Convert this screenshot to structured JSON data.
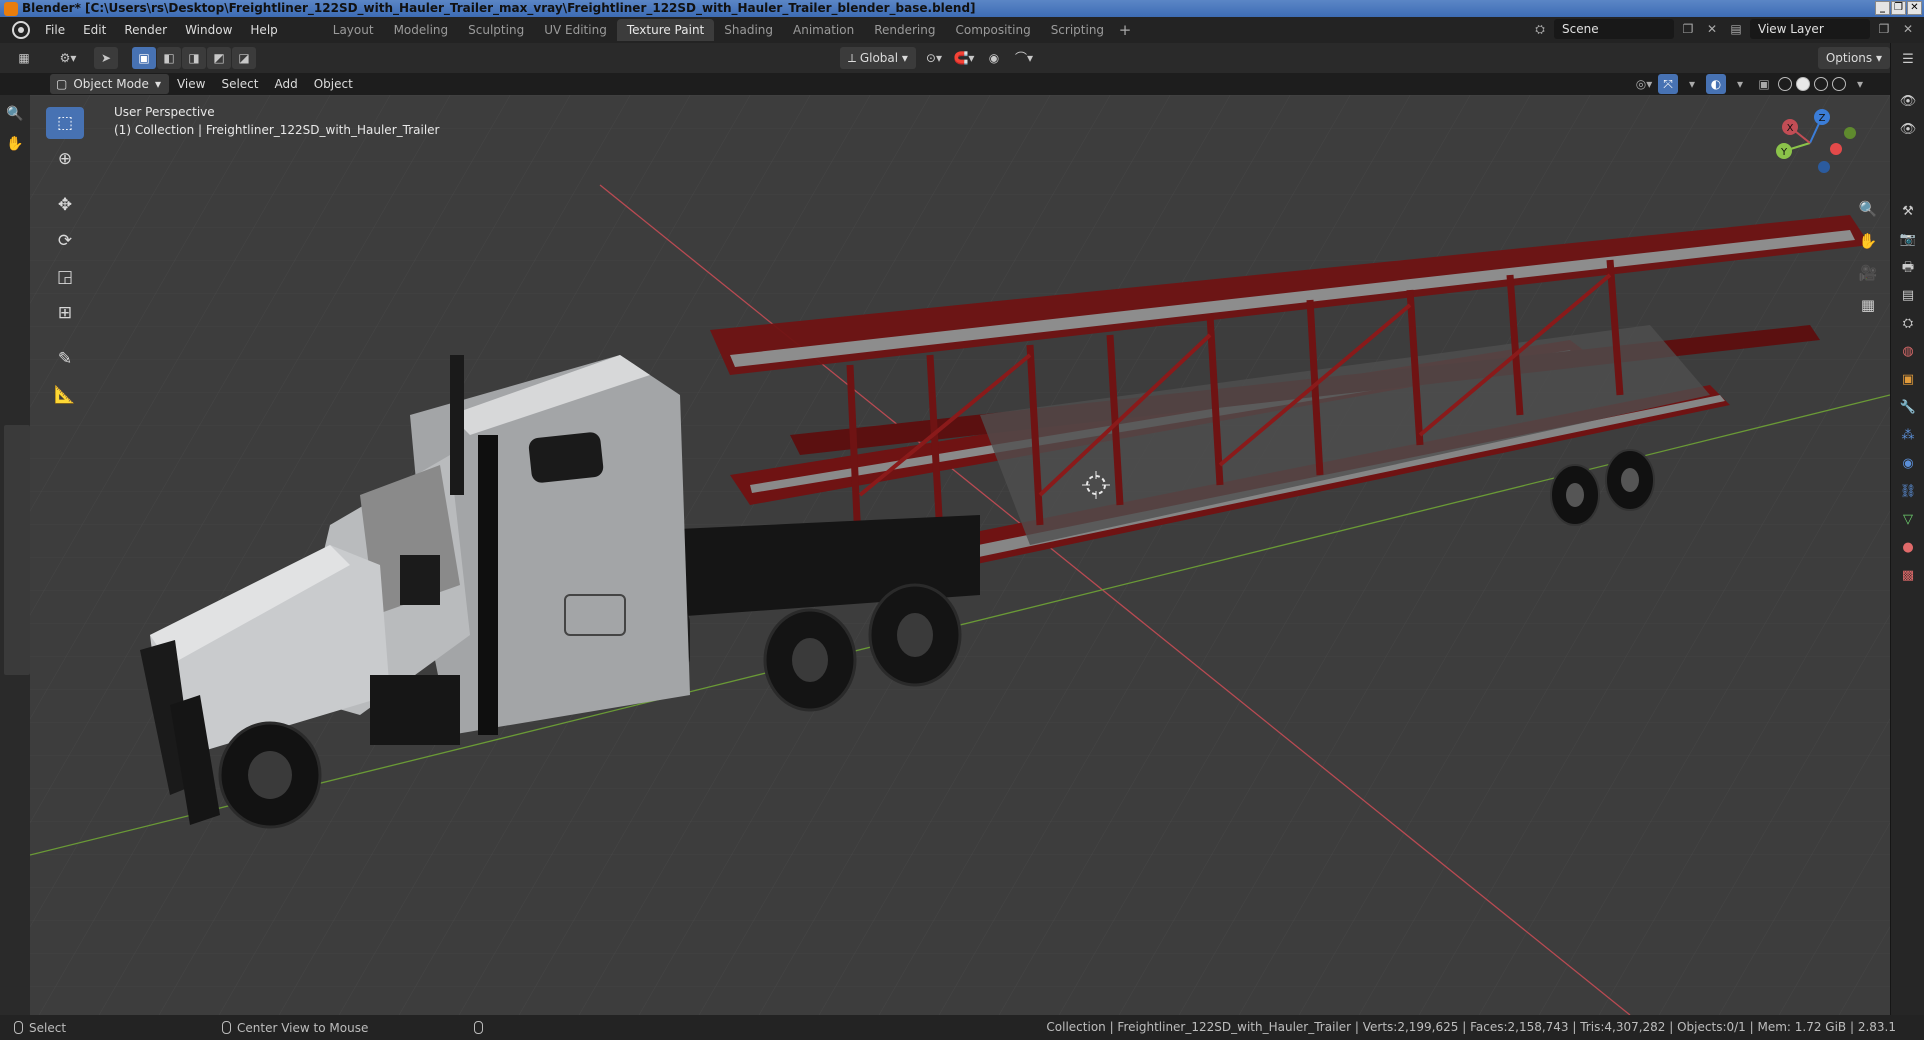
{
  "window": {
    "title": "Blender* [C:\\Users\\rs\\Desktop\\Freightliner_122SD_with_Hauler_Trailer_max_vray\\Freightliner_122SD_with_Hauler_Trailer_blender_base.blend]",
    "controls": [
      "_",
      "❐",
      "✕"
    ]
  },
  "menubar": {
    "items": [
      "File",
      "Edit",
      "Render",
      "Window",
      "Help"
    ]
  },
  "workspaces": {
    "tabs": [
      "Layout",
      "Modeling",
      "Sculpting",
      "UV Editing",
      "Texture Paint",
      "Shading",
      "Animation",
      "Rendering",
      "Compositing",
      "Scripting"
    ],
    "active": "Texture Paint",
    "add": "+"
  },
  "scene": {
    "scene_name": "Scene",
    "view_layer": "View Layer"
  },
  "tool_header": {
    "transform_orientation": "Global",
    "options": "Options"
  },
  "viewport_header": {
    "mode": "Object Mode",
    "menus": [
      "View",
      "Select",
      "Add",
      "Object"
    ]
  },
  "viewport": {
    "perspective_label": "User Perspective",
    "collection_label": "(1) Collection | Freightliner_122SD_with_Hauler_Trailer",
    "accent_colors": {
      "x_axis": "#b84a52",
      "y_axis": "#6a9a36",
      "trailer": "#7a1515",
      "cab": "#c9cbcd",
      "selection": "#4772b3"
    },
    "gizmo": {
      "x": "X",
      "y": "Y",
      "z": "Z"
    }
  },
  "toolbar": {
    "tools": [
      "select-box-icon",
      "cursor-icon",
      "move-icon",
      "rotate-icon",
      "scale-icon",
      "transform-icon",
      "annotate-icon",
      "measure-icon"
    ]
  },
  "statusbar": {
    "select": "Select",
    "center_view": "Center View to Mouse",
    "stats": "Collection | Freightliner_122SD_with_Hauler_Trailer | Verts:2,199,625 | Faces:2,158,743 | Tris:4,307,282 | Objects:0/1 | Mem: 1.72 GiB | 2.83.1"
  }
}
